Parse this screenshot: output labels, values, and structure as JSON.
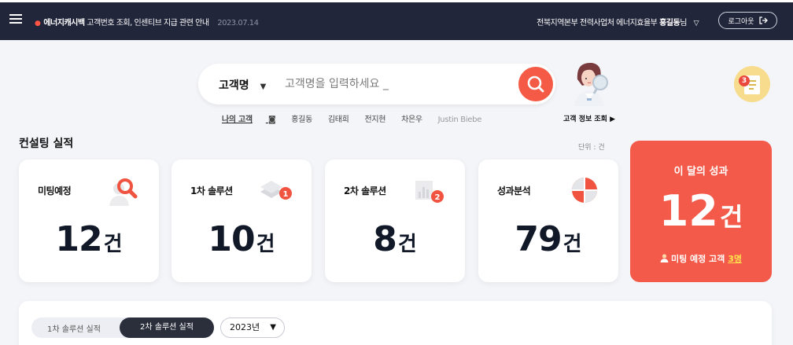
{
  "header": {
    "notice_brand": "에너지캐시백",
    "notice_text": "고객번호 조회, 인센티브 지급 관련 안내",
    "notice_date": "2023.07.14",
    "org": "전북지역본부 전력사업처 에너지효율부",
    "user_name": "홍길동",
    "user_suffix": "님",
    "logout_label": "로그아웃"
  },
  "search": {
    "select_value": "고객명",
    "placeholder": "고객명을 입력하세요 _",
    "quick_label": "나의 고객",
    "quick_names": [
      "홍길동",
      "김태희",
      "전지현",
      "차은우",
      "Justin Biebe"
    ],
    "customer_info_link": "고객 정보 조회 ▶"
  },
  "notifications": {
    "count": "3"
  },
  "consulting": {
    "title": "컨설팅 실적",
    "unit": "단위 : 건",
    "suffix": "건",
    "cards": [
      {
        "label": "미팅예정",
        "value": "12",
        "icon": "magnifier-icon"
      },
      {
        "label": "1차 솔루션",
        "value": "10",
        "icon": "layers-icon",
        "badge": "1"
      },
      {
        "label": "2차 솔루션",
        "value": "8",
        "icon": "bar-chart-icon",
        "badge": "2"
      },
      {
        "label": "성과분석",
        "value": "79",
        "icon": "pie-chart-icon"
      }
    ],
    "monthly": {
      "title": "이 달의 성과",
      "value": "12",
      "suffix": "건",
      "meeting_label": "미팅 예정 고객",
      "meeting_count": "3명"
    }
  },
  "performance": {
    "tabs": [
      "1차 솔루션 실적",
      "2차 솔루션 실적"
    ],
    "active_tab": 1,
    "year": "2023년"
  },
  "colors": {
    "accent": "#f35a49",
    "navy": "#22263a",
    "highlight": "#ffe14d"
  }
}
